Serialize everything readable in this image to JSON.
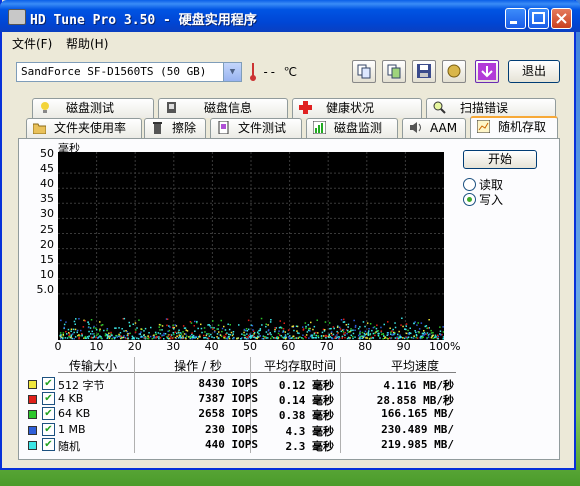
{
  "window": {
    "title": "HD Tune Pro 3.50 - 硬盘实用程序"
  },
  "menu": {
    "file": "文件(F)",
    "help": "帮助(H)"
  },
  "toolbar": {
    "device": "SandForce SF-D1560TS (50 GB)",
    "temp": "-- ℃",
    "exit_label": "退出"
  },
  "tabs_top": [
    {
      "label": "磁盘测试",
      "icon": "benchmark-icon"
    },
    {
      "label": "磁盘信息",
      "icon": "info-icon"
    },
    {
      "label": "健康状况",
      "icon": "health-cross-icon"
    },
    {
      "label": "扫描错误",
      "icon": "magnifier-icon"
    }
  ],
  "tabs_bottom": [
    {
      "label": "文件夹使用率",
      "icon": "folder-icon"
    },
    {
      "label": "擦除",
      "icon": "trash-icon"
    },
    {
      "label": "文件测试",
      "icon": "file-test-icon"
    },
    {
      "label": "磁盘监测",
      "icon": "monitor-chart-icon"
    },
    {
      "label": "AAM",
      "icon": "speaker-icon"
    },
    {
      "label": "随机存取",
      "icon": "random-access-icon"
    }
  ],
  "graph": {
    "y_unit": "毫秒",
    "y_ticks": [
      "50",
      "45",
      "40",
      "35",
      "30",
      "25",
      "20",
      "15",
      "10",
      "5.0"
    ],
    "x_ticks": [
      "0",
      "10",
      "20",
      "30",
      "40",
      "50",
      "60",
      "70",
      "80",
      "90",
      "100%"
    ]
  },
  "controls": {
    "start": "开始",
    "read": "读取",
    "write": "写入",
    "mode": "write"
  },
  "table": {
    "headers": [
      "传输大小",
      "操作 / 秒",
      "平均存取时间",
      "平均速度"
    ],
    "rows": [
      {
        "color": "#f0e63c",
        "size": "512 字节",
        "ops": "8430 IOPS",
        "access": "0.12 毫秒",
        "speed": "4.116 MB/秒"
      },
      {
        "color": "#e0201a",
        "size": "4 KB",
        "ops": "7387 IOPS",
        "access": "0.14 毫秒",
        "speed": "28.858 MB/秒"
      },
      {
        "color": "#2cc62c",
        "size": "64 KB",
        "ops": "2658 IOPS",
        "access": "0.38 毫秒",
        "speed": "166.165 MB/"
      },
      {
        "color": "#2f5fd8",
        "size": "1 MB",
        "ops": "230 IOPS",
        "access": "4.3 毫秒",
        "speed": "230.489 MB/"
      },
      {
        "color": "#3ce6e6",
        "size": "随机",
        "ops": "440 IOPS",
        "access": "2.3 毫秒",
        "speed": "219.985 MB/"
      }
    ]
  }
}
